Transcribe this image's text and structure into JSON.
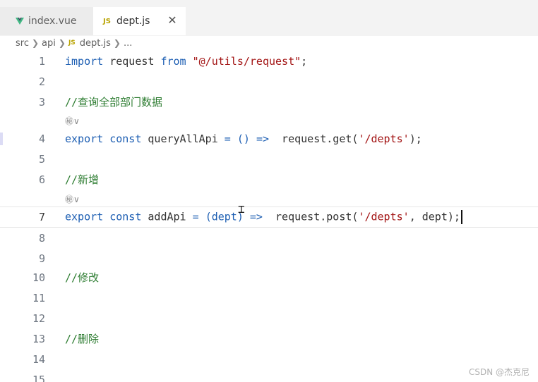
{
  "tabs": [
    {
      "label": "index.vue",
      "icon": "vue-icon",
      "active": false
    },
    {
      "label": "dept.js",
      "icon": "js-icon",
      "active": true,
      "badge": "JS"
    }
  ],
  "close_glyph": "✕",
  "breadcrumb": {
    "items": [
      "src",
      "api",
      "dept.js"
    ],
    "js_badge": "JS",
    "trailing": "..."
  },
  "lines": {
    "l1": {
      "num": "1",
      "kw1": "import",
      "id": " request ",
      "kw2": "from",
      "sp": " ",
      "str": "\"@/utils/request\"",
      "end": ";"
    },
    "l2": {
      "num": "2"
    },
    "l3": {
      "num": "3",
      "comment": "//查询全部部门数据"
    },
    "lens1": "㊙∨",
    "l4": {
      "num": "4",
      "kw1": "export",
      "sp1": " ",
      "kw2": "const",
      "id": " queryAllApi ",
      "op": "=",
      "sp2": " ",
      "args": "()",
      "sp3": " ",
      "arrow": "=>",
      "call": "  request.get(",
      "str": "'/depts'",
      "end": ");"
    },
    "l5": {
      "num": "5"
    },
    "l6": {
      "num": "6",
      "comment": "//新增"
    },
    "lens2": "㊙∨",
    "l7": {
      "num": "7",
      "kw1": "export",
      "sp1": " ",
      "kw2": "const",
      "id": " addApi ",
      "op": "=",
      "sp2": " ",
      "args": "(dept)",
      "sp3": " ",
      "arrow": "=>",
      "call": "  request.post(",
      "str": "'/depts'",
      "end": ", dept);"
    },
    "l8": {
      "num": "8"
    },
    "l9": {
      "num": "9"
    },
    "l10": {
      "num": "10",
      "comment": "//修改"
    },
    "l11": {
      "num": "11"
    },
    "l12": {
      "num": "12"
    },
    "l13": {
      "num": "13",
      "comment": "//删除"
    },
    "l14": {
      "num": "14"
    },
    "l15": {
      "num": "15"
    }
  },
  "watermark": "CSDN @杰克尼",
  "colors": {
    "keyword": "#1e5fb3",
    "string": "#a31515",
    "comment": "#2e7d32",
    "vue_green": "#41b883",
    "js_yellow": "#b8a300"
  }
}
